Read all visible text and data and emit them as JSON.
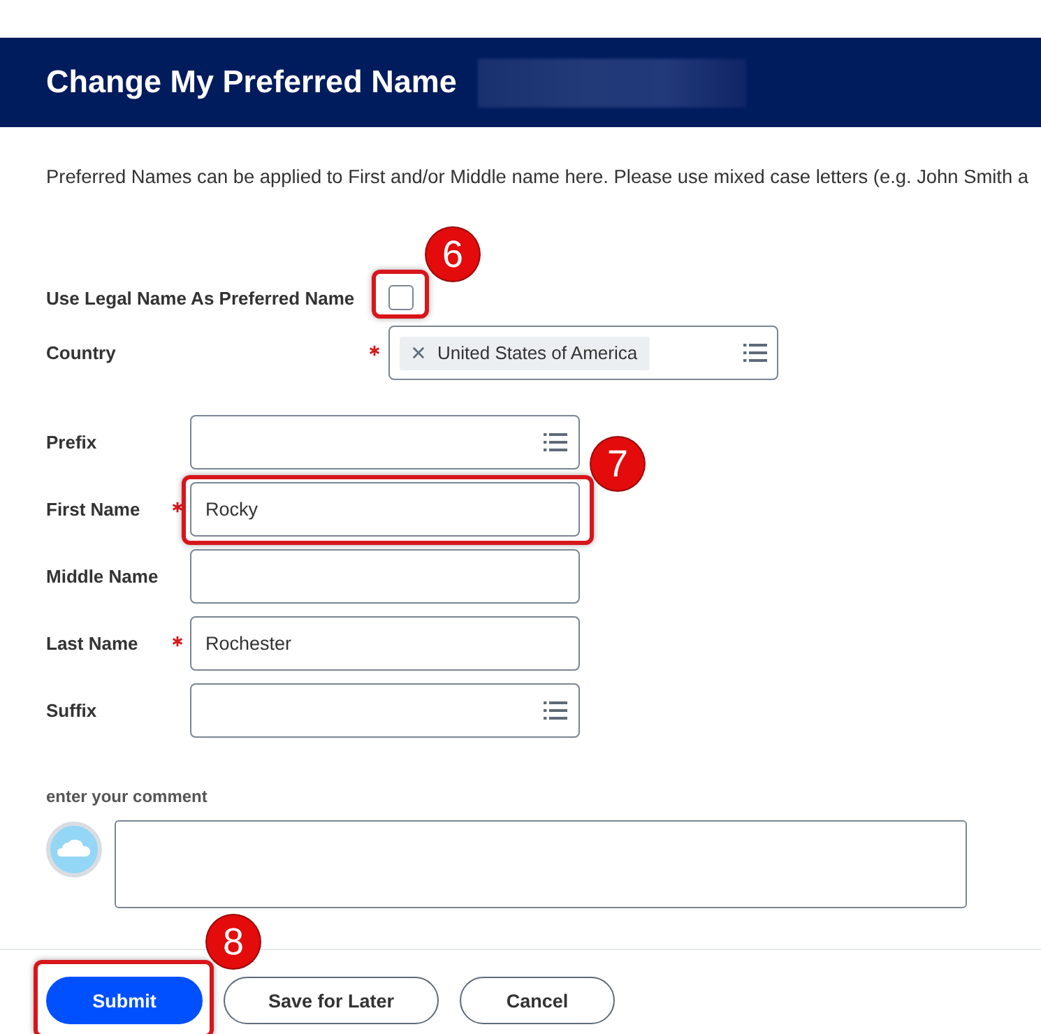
{
  "header": {
    "title": "Change My Preferred Name",
    "redacted_name": true
  },
  "description": "Preferred Names can be applied to First and/or Middle name here. Please use mixed case letters (e.g. John Smith a",
  "legal_name_option": {
    "label": "Use Legal Name As Preferred Name",
    "checked": false,
    "callout": "6"
  },
  "country": {
    "label": "Country",
    "required": true,
    "chip": "United States of America"
  },
  "name_fields": [
    {
      "label": "Prefix",
      "kind": "select",
      "required": false
    },
    {
      "label": "First Name",
      "kind": "text",
      "required": true,
      "value": "Rocky",
      "callout": "7"
    },
    {
      "label": "Middle Name",
      "kind": "text",
      "required": false
    },
    {
      "label": "Last Name",
      "kind": "text",
      "required": true,
      "value": "Rochester"
    },
    {
      "label": "Suffix",
      "kind": "select",
      "required": false
    }
  ],
  "comment": {
    "label": "enter your comment"
  },
  "buttons": [
    {
      "label": "Submit",
      "kind": "primary",
      "callout": "8"
    },
    {
      "label": "Save for Later",
      "kind": "secondary"
    },
    {
      "label": "Cancel",
      "kind": "secondary"
    }
  ]
}
